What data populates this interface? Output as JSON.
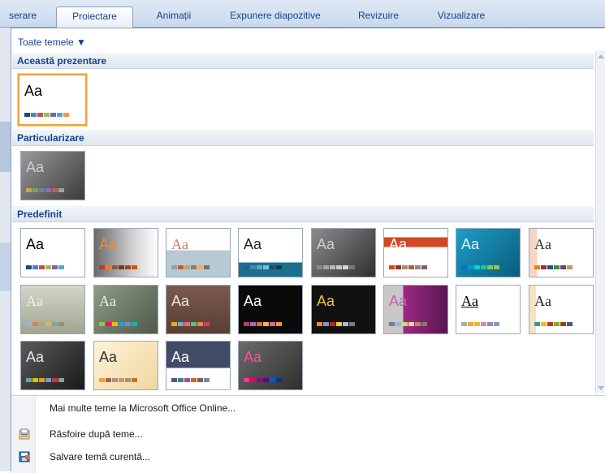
{
  "tabs": [
    {
      "id": "inserare",
      "label": "serare",
      "active": false
    },
    {
      "id": "proiectare",
      "label": "Proiectare",
      "active": true
    },
    {
      "id": "animatii",
      "label": "Animații",
      "active": false
    },
    {
      "id": "expunere",
      "label": "Expunere diapozitive",
      "active": false
    },
    {
      "id": "revizuire",
      "label": "Revizuire",
      "active": false
    },
    {
      "id": "vizualizare",
      "label": "Vizualizare",
      "active": false
    }
  ],
  "gallery": {
    "filter_label": "Toate temele ▼",
    "sections": {
      "current": "Această prezentare",
      "custom": "Particularizare",
      "builtin": "Predefinit"
    },
    "tile_text": "Aa"
  },
  "menu": {
    "more_themes": "Mai multe teme la Microsoft Office Online...",
    "browse_themes": "Răsfoire după teme...",
    "save_theme": "Salvare temă curentă..."
  },
  "colors": {
    "accent": "#15428b",
    "selection": "#f0a03a"
  }
}
